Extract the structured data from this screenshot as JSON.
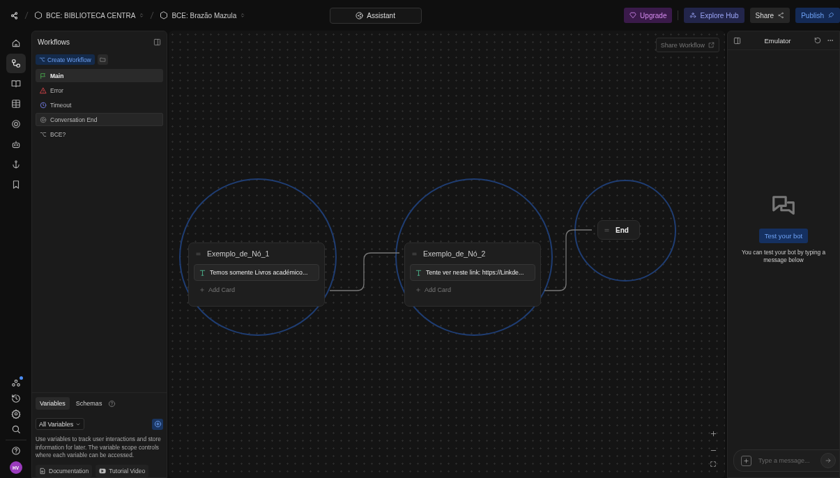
{
  "topbar": {
    "breadcrumbs": [
      {
        "label": "BCE: BIBLIOTECA CENTRA"
      },
      {
        "label": "BCE: Brazão Mazula"
      }
    ],
    "assistant": "Assistant",
    "buttons": [
      {
        "label": "Upgrade",
        "kind": "upgrade"
      },
      {
        "label": "Explore Hub",
        "kind": "hub"
      },
      {
        "label": "Share",
        "kind": "share"
      },
      {
        "label": "Publish",
        "kind": "publish"
      }
    ]
  },
  "rail": {
    "items": [
      {
        "selected": false
      },
      {
        "selected": true
      },
      {
        "selected": false
      },
      {
        "selected": false
      },
      {
        "selected": false
      },
      {
        "selected": false
      },
      {
        "selected": false
      },
      {
        "selected": false
      }
    ],
    "avatar": "HV"
  },
  "sidebar": {
    "title": "Workflows",
    "create_button": "Create Workflow",
    "workflows": [
      {
        "label": "Main",
        "kind": "main",
        "selected": true,
        "hovered": false
      },
      {
        "label": "Error",
        "kind": "error",
        "selected": false,
        "hovered": false
      },
      {
        "label": "Timeout",
        "kind": "timeout",
        "selected": false,
        "hovered": false
      },
      {
        "label": "Conversation End",
        "kind": "end",
        "selected": false,
        "hovered": true
      },
      {
        "label": "BCE?",
        "kind": "branch",
        "selected": false,
        "hovered": false
      }
    ]
  },
  "variables": {
    "tabs": [
      {
        "label": "Variables",
        "selected": true
      },
      {
        "label": "Schemas",
        "selected": false
      }
    ],
    "filter": "All Variables",
    "description": "Use variables to track user interactions and store information for later. The variable scope controls where each variable can be accessed.",
    "links": [
      {
        "label": "Documentation",
        "kind": "doc"
      },
      {
        "label": "Tutorial Video",
        "kind": "video"
      }
    ]
  },
  "canvas": {
    "share_button": "Share Workflow",
    "nodes": [
      {
        "title": "Exemplo_de_Nó_1",
        "card": "Temos somente Livros académico...",
        "add_card": "Add Card"
      },
      {
        "title": "Exemplo_de_Nó_2",
        "card": "Tente ver neste link: https://Linkde...",
        "add_card": "Add Card"
      }
    ],
    "end_node": "End"
  },
  "emulator": {
    "title": "Emulator",
    "test_button": "Test your bot",
    "hint": "You can test your bot by typing a message below",
    "input_placeholder": "Type a message..."
  }
}
